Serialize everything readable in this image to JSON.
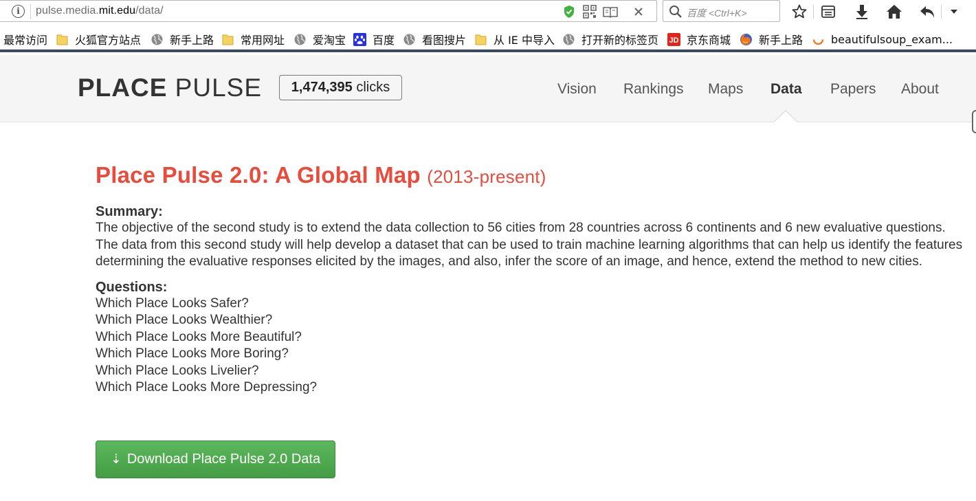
{
  "browser": {
    "url_prefix": "pulse.media.",
    "url_host": "mit.edu",
    "url_suffix": "/data/",
    "search_placeholder": "百度 <Ctrl+K>"
  },
  "bookmarks": [
    {
      "label": "最常访问",
      "icon": "none"
    },
    {
      "label": "火狐官方站点",
      "icon": "folder-icon"
    },
    {
      "label": "新手上路",
      "icon": "globe-icon"
    },
    {
      "label": "常用网址",
      "icon": "folder-icon"
    },
    {
      "label": "爱淘宝",
      "icon": "globe-icon"
    },
    {
      "label": "百度",
      "icon": "baidu-paw-icon"
    },
    {
      "label": "看图搜片",
      "icon": "globe-icon"
    },
    {
      "label": "从 IE 中导入",
      "icon": "folder-icon"
    },
    {
      "label": "打开新的标签页",
      "icon": "globe-icon"
    },
    {
      "label": "京东商城",
      "icon": "jd-icon"
    },
    {
      "label": "新手上路",
      "icon": "firefox-icon"
    },
    {
      "label": "beautifulsoup_exam...",
      "icon": "spinner-icon"
    }
  ],
  "site": {
    "logo_bold": "PLACE",
    "logo_light": " PULSE",
    "clicks_count": "1,474,395",
    "clicks_label": " clicks",
    "nav": [
      "Vision",
      "Rankings",
      "Maps",
      "Data",
      "Papers",
      "About"
    ],
    "nav_active": "Data"
  },
  "content": {
    "title": "Place Pulse 2.0: A Global Map",
    "title_sub": "(2013-present)",
    "summary_label": "Summary:",
    "summary_text": "The objective of the second study is to extend the data collection to 56 cities from 28 countries across 6 continents and 6 new evaluative questions. The data from this second study will help develop a dataset that can be used to train machine learning algorithms that can help us identify the features determining the evaluative responses elicited by the images, and also, infer the score of an image, and hence, extend the method to new cities.",
    "questions_label": "Questions:",
    "questions": [
      "Which Place Looks Safer?",
      "Which Place Looks Wealthier?",
      "Which Place Looks More Beautiful?",
      "Which Place Looks More Boring?",
      "Which Place Looks Livelier?",
      "Which Place Looks More Depressing?"
    ],
    "download_label": "Download Place Pulse 2.0 Data"
  },
  "colors": {
    "accent_red": "#e74c3c",
    "button_green": "#5cb85c",
    "header_bg": "#f5f5f5"
  }
}
